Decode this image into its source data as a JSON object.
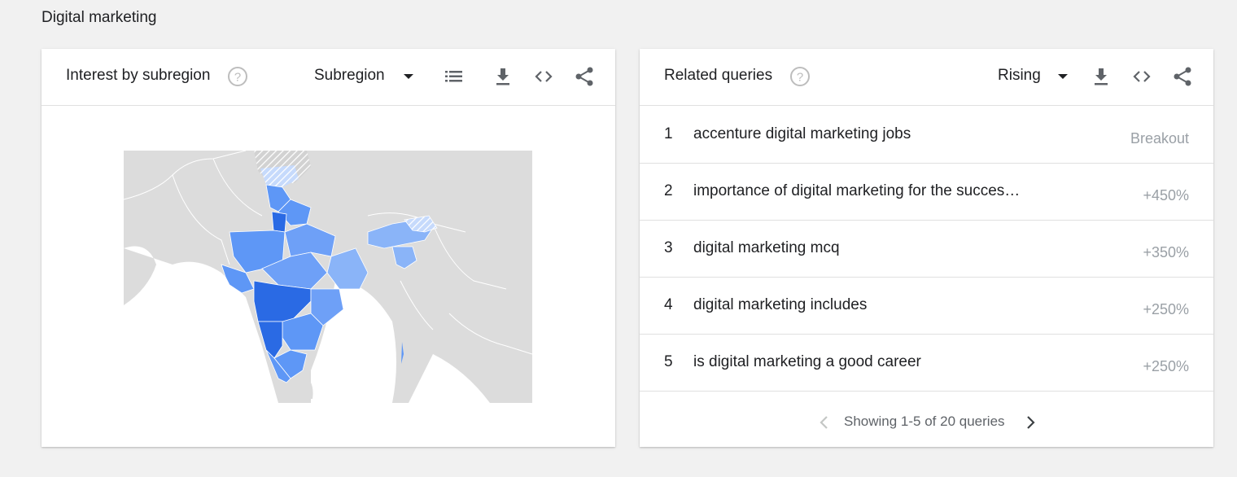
{
  "page": {
    "section_title": "Digital marketing"
  },
  "left_card": {
    "title": "Interest by subregion",
    "dropdown_label": "Subregion",
    "icons": [
      "help-icon",
      "list-icon",
      "download-icon",
      "embed-icon",
      "share-icon"
    ],
    "map": {
      "base_color": "#dcdcdc",
      "highlight_light": "#8ab4f8",
      "highlight_mid": "#5e97f6",
      "highlight_dark": "#2a6ae4"
    }
  },
  "right_card": {
    "title": "Related queries",
    "dropdown_label": "Rising",
    "icons": [
      "help-icon",
      "download-icon",
      "embed-icon",
      "share-icon"
    ],
    "rows": [
      {
        "rank": "1",
        "query": "accenture digital marketing jobs",
        "value": "Breakout"
      },
      {
        "rank": "2",
        "query": "importance of digital marketing for the succes…",
        "value": "+450%"
      },
      {
        "rank": "3",
        "query": "digital marketing mcq",
        "value": "+350%"
      },
      {
        "rank": "4",
        "query": "digital marketing includes",
        "value": "+250%"
      },
      {
        "rank": "5",
        "query": "is digital marketing a good career",
        "value": "+250%"
      }
    ],
    "pager_text": "Showing 1-5 of 20 queries"
  }
}
